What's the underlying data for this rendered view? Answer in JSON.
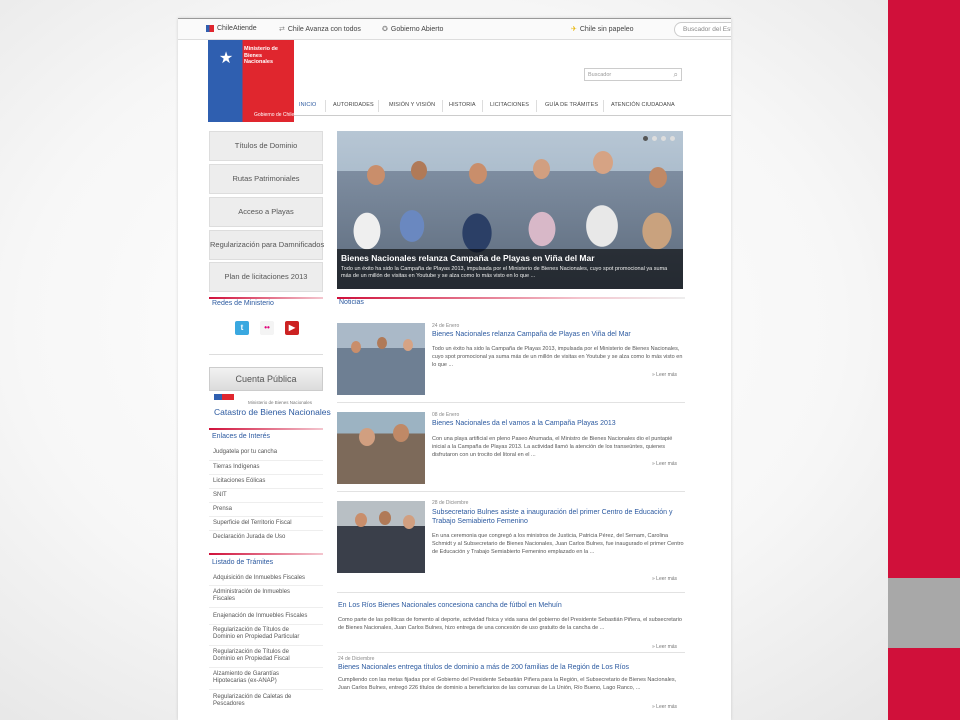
{
  "topbar": {
    "chile_atiende": "ChileAtiende",
    "chile_avanza": "Chile Avanza con todos",
    "gobierno_abierto": "Gobierno Abierto",
    "chile_sin_papeleo": "Chile sin papeleo",
    "search_placeholder": "Buscador del Estado"
  },
  "logo": {
    "title": "Ministerio de Bienes Nacionales",
    "subtitle": "Gobierno de Chile"
  },
  "site_search": {
    "placeholder": "Buscador"
  },
  "nav": [
    "INICIO",
    "AUTORIDADES",
    "MISIÓN Y VISIÓN",
    "HISTORIA",
    "LICITACIONES",
    "GUÍA DE TRÁMITES",
    "ATENCIÓN CIUDADANA"
  ],
  "left_buttons": [
    "Títulos de Dominio",
    "Rutas Patrimoniales",
    "Acceso a Playas",
    "Regularización para Damnificados",
    "Plan de licitaciones 2013"
  ],
  "redes": {
    "title": "Redes de Ministerio"
  },
  "cuenta_publica": "Cuenta Pública",
  "catastro": {
    "small": "Ministerio de Bienes Nacionales",
    "big": "Catastro de Bienes Nacionales"
  },
  "enlaces": {
    "title": "Enlaces de Interés",
    "items": [
      "Judgatela por tu cancha",
      "Tierras Indígenas",
      "Licitaciones Eólicas",
      "SNIT",
      "Prensa",
      "Superficie del Territorio Fiscal",
      "Declaración Jurada de Uso"
    ]
  },
  "tramites": {
    "title": "Listado de Trámites",
    "items": [
      "Adquisición de Inmuebles Fiscales",
      "Administración de Inmuebles Fiscales",
      "Enajenación de Inmuebles Fiscales",
      "Regularización de Títulos de Dominio en Propiedad Particular",
      "Regularización de Títulos de Dominio en Propiedad Fiscal",
      "Alzamiento de Garantías Hipotecarias (ex-ANAP)",
      "Regularización de Caletas de Pescadores"
    ]
  },
  "slider": {
    "title": "Bienes Nacionales relanza Campaña de Playas en Viña del Mar",
    "text": "Todo un éxito ha sido la Campaña de Playas 2013, impulsada por el Ministerio de Bienes Nacionales, cuyo spot promocional ya suma más de un millón de visitas en Youtube y se alza como lo más visto en lo que ..."
  },
  "news": {
    "title": "Noticias",
    "more": "» Leer más",
    "items": [
      {
        "date": "24 de Enero",
        "headline": "Bienes Nacionales relanza Campaña de Playas en Viña del Mar",
        "body": "Todo un éxito ha sido la Campaña de Playas 2013, impulsada por el Ministerio de Bienes Nacionales, cuyo spot promocional ya suma más de un millón de visitas en Youtube y se alza como lo más visto en lo que ..."
      },
      {
        "date": "08 de Enero",
        "headline": "Bienes Nacionales da el vamos a la Campaña Playas 2013",
        "body": "Con una playa artificial en pleno Paseo Ahumada, el Ministro de Bienes Nacionales dio el puntapié inicial a la Campaña de Playas 2013. La actividad llamó la atención de los transeúntes, quienes disfrutaron con un trocito del litoral en el ..."
      },
      {
        "date": "28 de Diciembre",
        "headline": "Subsecretario Bulnes asiste a inauguración del primer Centro de Educación y Trabajo Semiabierto Femenino",
        "body": "En una ceremonia que congregó a los ministros de Justicia, Patricia Pérez, del Sernam, Carolina Schmidt y al Subsecretario de Bienes Nacionales, Juan Carlos Bulnes, fue inaugurado el primer Centro de Educación y Trabajo Semiabierto Femenino emplazado en la ..."
      }
    ],
    "wide": [
      {
        "headline": "En Los Ríos Bienes Nacionales concesiona cancha de fútbol en Mehuín",
        "body": "Como parte de las políticas de fomento al deporte, actividad física y vida sana del gobierno del Presidente Sebastián Piñera, el subsecretario de Bienes Nacionales, Juan Carlos Bulnes, hizo entrega de una concesión de uso gratuito de la cancha de ..."
      },
      {
        "date": "24 de Diciembre",
        "headline": "Bienes Nacionales entrega títulos de dominio a más de 200 familias de la Región de Los Ríos",
        "body": "Cumpliendo con las metas fijadas por el Gobierno del Presidente Sebastián Piñera para la Región, el Subsecretario de Bienes Nacionales, Juan Carlos Bulnes, entregó 226 títulos de dominio a beneficiarios de las comunas de La Unión, Río Bueno, Lago Ranco, ..."
      }
    ]
  },
  "colors": {
    "accent_red": "#d0103a",
    "link_blue": "#2c5aa0",
    "gray_bar": "#a8a8a8"
  }
}
